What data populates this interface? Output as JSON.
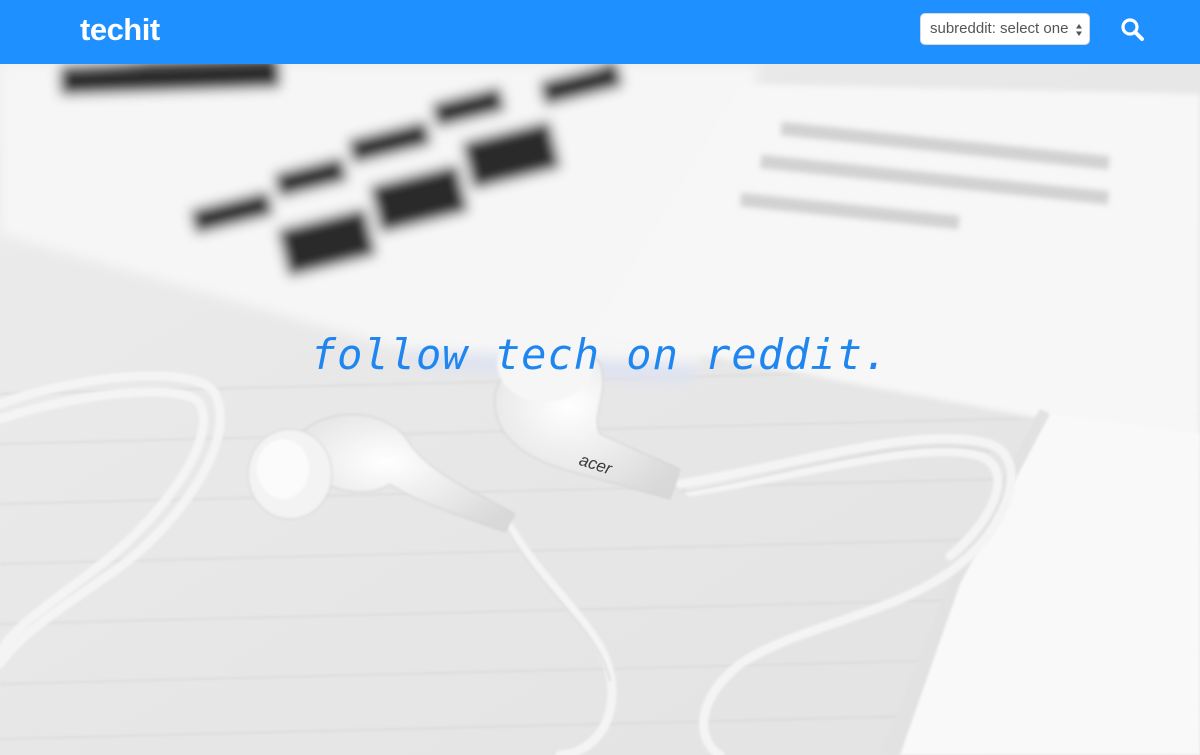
{
  "navbar": {
    "brand": "techit",
    "subreddit_select": {
      "value": "subreddit: select one"
    },
    "search_icon": "search-icon",
    "background_color": "#1e90ff"
  },
  "hero": {
    "tagline": "follow tech on reddit.",
    "tagline_color": "#1f86f0",
    "earbud_brand": "acer"
  }
}
